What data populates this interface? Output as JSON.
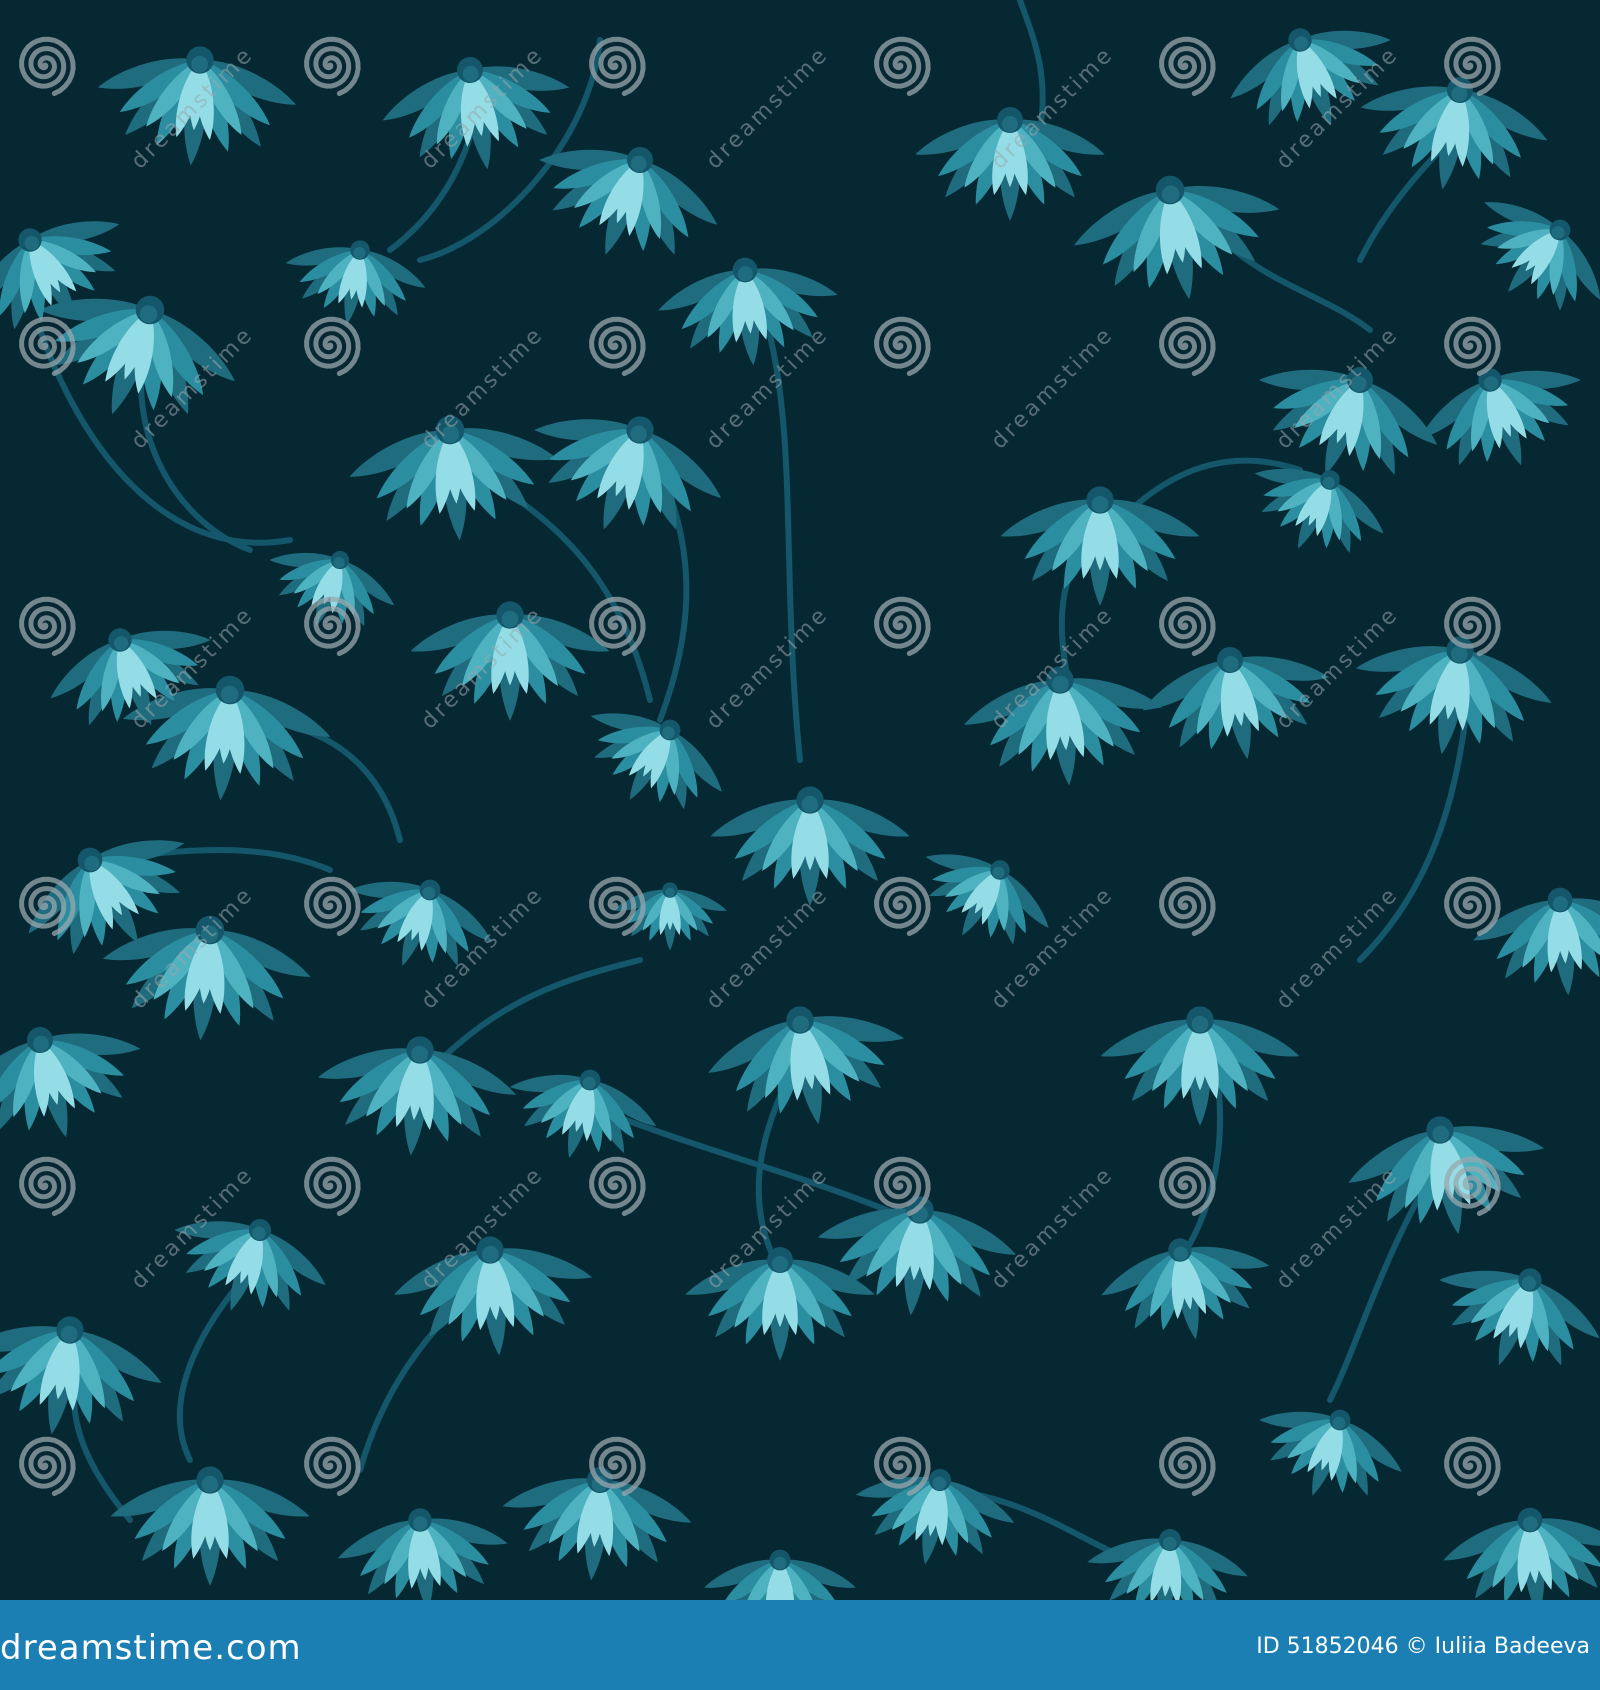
{
  "image": {
    "subject": "seamless floral pattern",
    "background_color": "#062833",
    "petal_colors": [
      "#94dde6",
      "#4fb2c0",
      "#2b8ea0",
      "#1f6c7e"
    ],
    "stem_color": "#14566a",
    "watermark_color": "#9aa7ad"
  },
  "watermark": {
    "text": "dreamstime",
    "icon": "spiral-logo-icon"
  },
  "footer": {
    "brand": "dreamstime.com",
    "credit": "ID 51852046 © Iuliia Badeeva",
    "background_color": "#1b7fb3",
    "text_color": "#ffffff"
  }
}
